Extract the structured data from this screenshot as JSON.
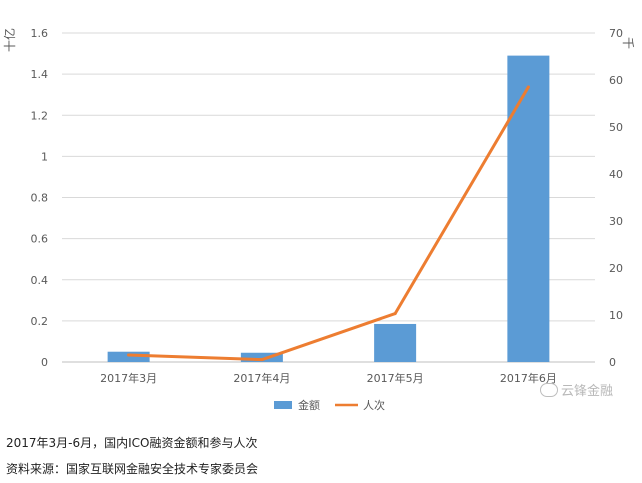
{
  "chart_data": {
    "type": "bar+line",
    "categories": [
      "2017年3月",
      "2017年4月",
      "2017年5月",
      "2017年6月"
    ],
    "series": [
      {
        "name": "金额",
        "type": "bar",
        "axis": "left",
        "color": "#5b9bd5",
        "values": [
          0.05,
          0.045,
          0.185,
          1.49
        ]
      },
      {
        "name": "人次",
        "type": "line",
        "axis": "right",
        "color": "#ed7d31",
        "values": [
          1.5,
          0.5,
          10.3,
          58.5
        ]
      }
    ],
    "left_axis": {
      "unit": "十亿",
      "ylim": [
        0,
        1.6
      ],
      "ticks": [
        "0",
        "0.2",
        "0.4",
        "0.6",
        "0.8",
        "1",
        "1.2",
        "1.4",
        "1.6"
      ]
    },
    "right_axis": {
      "unit": "千",
      "ylim": [
        0,
        70
      ],
      "ticks": [
        "0",
        "10",
        "20",
        "30",
        "40",
        "50",
        "60",
        "70"
      ]
    },
    "grid": true,
    "legend_position": "bottom"
  },
  "caption": "2017年3月-6月，国内ICO融资金额和参与人次",
  "source": "资料来源：国家互联网金融安全技术专家委员会",
  "watermark": "云锋金融"
}
